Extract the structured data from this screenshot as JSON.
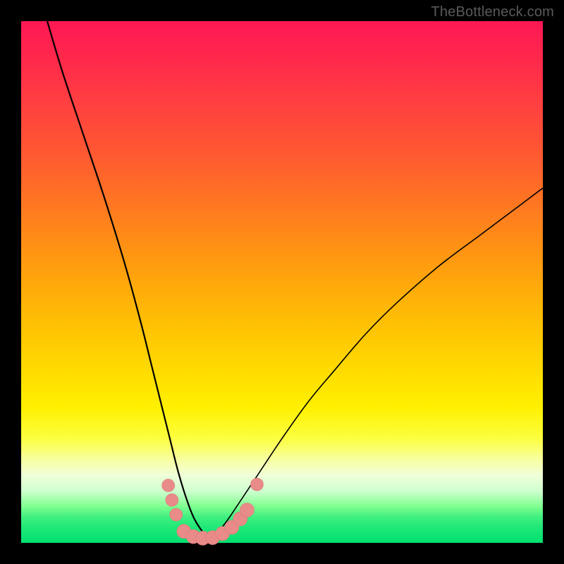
{
  "watermark": "TheBottleneck.com",
  "colors": {
    "background": "#000000",
    "curve": "#000000",
    "marker_fill": "#e98b88",
    "marker_stroke": "#d87a78",
    "gradient_top": "#ff1854",
    "gradient_bottom": "#00e070"
  },
  "chart_data": {
    "type": "line",
    "title": "",
    "xlabel": "",
    "ylabel": "",
    "xlim": [
      0,
      100
    ],
    "ylim": [
      0,
      100
    ],
    "curve_left": {
      "x": [
        5,
        8,
        12,
        16,
        20,
        23,
        25,
        27,
        28.5,
        30,
        31.5,
        33,
        34.5,
        36
      ],
      "y": [
        100,
        90,
        78,
        66,
        53,
        42,
        34,
        26,
        20,
        14,
        9,
        5,
        2.5,
        0.8
      ]
    },
    "curve_right": {
      "x": [
        36,
        37,
        38.5,
        40,
        42,
        45,
        50,
        55,
        60,
        66,
        72,
        80,
        88,
        96,
        100
      ],
      "y": [
        0.8,
        1.5,
        3,
        5,
        8,
        12.5,
        20,
        27,
        33,
        40,
        46,
        53,
        59,
        65,
        68
      ]
    },
    "markers": [
      {
        "x": 28.2,
        "y": 11.0
      },
      {
        "x": 28.9,
        "y": 8.2
      },
      {
        "x": 29.7,
        "y": 5.4
      },
      {
        "x": 31.2,
        "y": 2.2
      },
      {
        "x": 33.0,
        "y": 1.2
      },
      {
        "x": 34.8,
        "y": 0.9
      },
      {
        "x": 36.7,
        "y": 1.0
      },
      {
        "x": 38.6,
        "y": 1.8
      },
      {
        "x": 40.4,
        "y": 3.0
      },
      {
        "x": 42.0,
        "y": 4.6
      },
      {
        "x": 43.3,
        "y": 6.3
      },
      {
        "x": 45.2,
        "y": 11.2
      }
    ],
    "marker_size_factor": 1.0,
    "marker_sizes": [
      9,
      9,
      9,
      10,
      10,
      10,
      10,
      10,
      10,
      10,
      10,
      9
    ]
  }
}
